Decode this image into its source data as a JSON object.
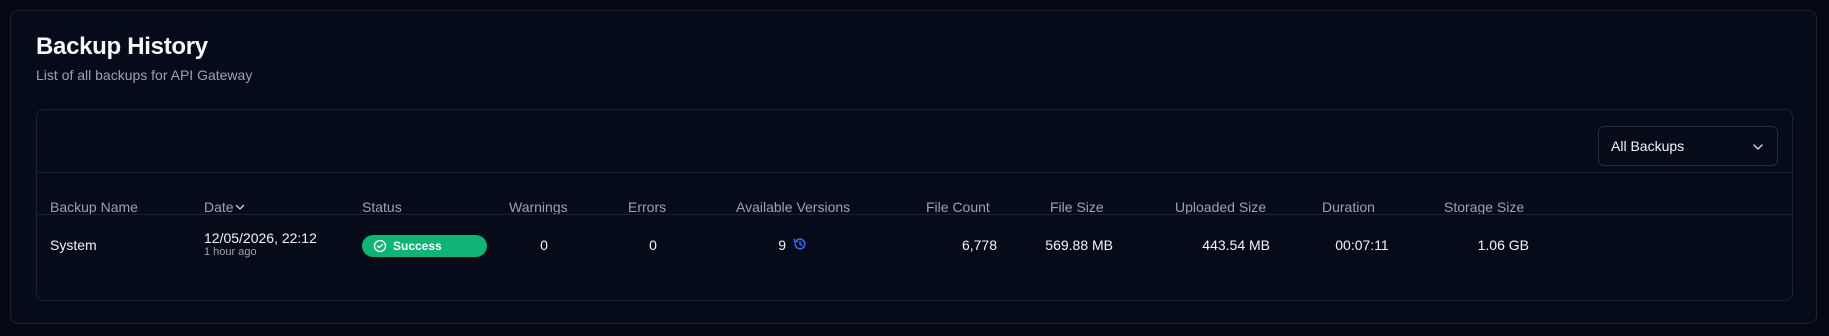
{
  "header": {
    "title": "Backup History",
    "subtitle": "List of all backups for API Gateway"
  },
  "filter": {
    "selected": "All Backups",
    "icon": "chevron-down-icon"
  },
  "table": {
    "columns": {
      "name": "Backup Name",
      "date": "Date",
      "status": "Status",
      "warnings": "Warnings",
      "errors": "Errors",
      "versions": "Available Versions",
      "file_count": "File Count",
      "file_size": "File Size",
      "uploaded_size": "Uploaded Size",
      "duration": "Duration",
      "storage_size": "Storage Size"
    },
    "sort": {
      "column": "Date",
      "direction": "descending",
      "icon": "chevron-down-icon"
    },
    "rows": [
      {
        "name": "System",
        "date": "12/05/2026, 22:12",
        "relative": "1 hour ago",
        "status": "Success",
        "status_icon": "check-circle-icon",
        "warnings": "0",
        "errors": "0",
        "versions": "9",
        "versions_icon": "history-icon",
        "file_count": "6,778",
        "file_size": "569.88 MB",
        "uploaded_size": "443.54 MB",
        "duration": "00:07:11",
        "storage_size": "1.06 GB"
      }
    ]
  },
  "colors": {
    "background": "#040814",
    "border": "#1b2231",
    "muted_text": "#9aa3b2",
    "success": "#0fb474",
    "accent": "#3b6cf6"
  }
}
